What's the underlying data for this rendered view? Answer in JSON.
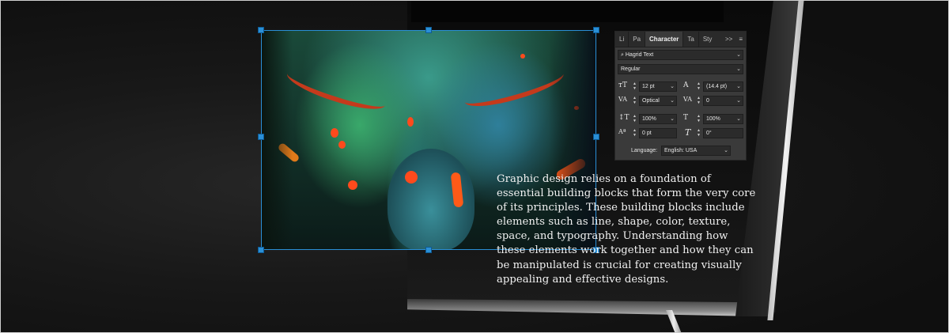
{
  "document": {
    "body_text": "Graphic design relies on a foundation of essential building blocks that form the very core of its principles. These building blocks include elements such as line, shape, color, texture, space, and typography.  Understanding how these elements work together and how they can be manipulated is crucial for creating visually appealing and effective designs."
  },
  "character_panel": {
    "tabs": [
      "Li",
      "Pa",
      "Character",
      "Ta",
      "Sty"
    ],
    "active_tab": "Character",
    "overflow_icon": ">>",
    "menu_icon": "≡",
    "font_family": "Hagrid Text",
    "font_style": "Regular",
    "font_size": "12 pt",
    "leading": "(14.4 pt)",
    "kerning": "Optical",
    "tracking": "0",
    "vertical_scale": "100%",
    "horizontal_scale": "100%",
    "baseline_shift": "0 pt",
    "skew": "0°",
    "language_label": "Language:",
    "language_value": "English: USA"
  },
  "colors": {
    "selection": "#2a8fd6",
    "panel_bg": "#3a3a3a",
    "text": "#f1f1f1"
  }
}
